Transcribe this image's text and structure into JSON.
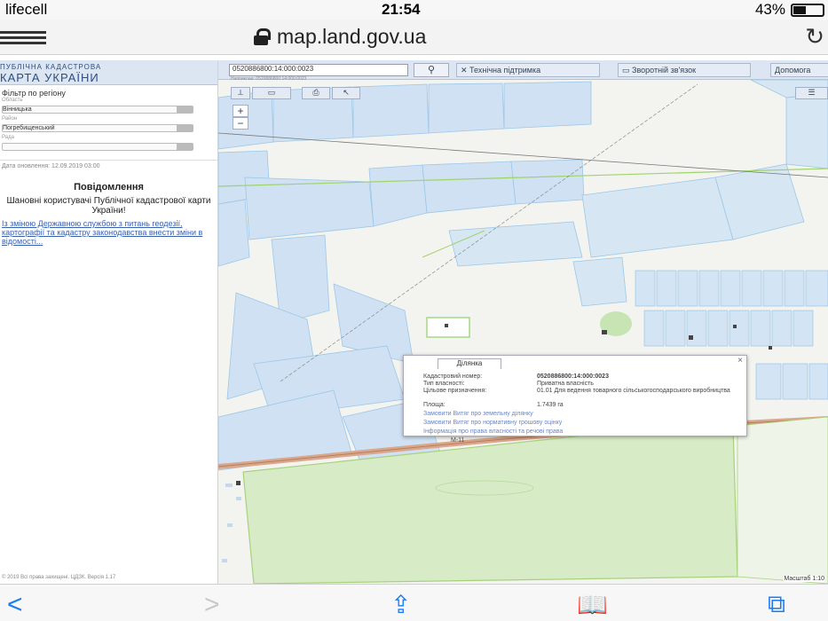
{
  "status": {
    "carrier": "lifecell",
    "time": "21:54",
    "battery": "43%"
  },
  "browser": {
    "url": "map.land.gov.ua"
  },
  "sidebar": {
    "title_small": "ПУБЛІЧНА КАДАСТРОВА",
    "title_large": "КАРТА УКРАЇНИ",
    "filter_label": "Фільтр по регіону",
    "region_label": "Область",
    "region_value": "Вінницька",
    "district_label": "Район",
    "district_value": "Погребищенський",
    "council_label": "Рада",
    "date": "Дата оновлення: 12.09.2019 03:00",
    "notice_title": "Повідомлення",
    "notice_body": "Шановні користувачі Публічної кадастрової карти України!",
    "notice_link": "Із зміною Державною службою з питань геодезії, картографії та кадастру законодавства внести зміни в відомості...",
    "footer": "© 2019 Всі права захищені. ЦДЗК. Версія 1.17"
  },
  "maptoolbar": {
    "search_value": "0520886800:14:000:0023",
    "search_hint": "Наприклад: 0520886800:14:000:0023",
    "buttons": [
      "Технічна підтримка",
      "Зворотній зв'язок",
      "Допомога"
    ]
  },
  "popup": {
    "tab": "Ділянка",
    "rows": [
      {
        "k": "Кадастровий номер:",
        "v": "0520886800:14:000:0023"
      },
      {
        "k": "Тип власності:",
        "v": "Приватна власність"
      },
      {
        "k": "Цільове призначення:",
        "v": "01.01 Для ведення товарного сільськогосподарського виробництва"
      },
      {
        "k": "Площа:",
        "v": "1.7439 га"
      }
    ],
    "links": [
      "Замовити Витяг про земельну ділянку",
      "Замовити Витяг про нормативну грошову оцінку",
      "Інформація про права власності та речові права"
    ]
  },
  "map": {
    "road_label": "М-11",
    "scale": "Масштаб 1:10"
  }
}
